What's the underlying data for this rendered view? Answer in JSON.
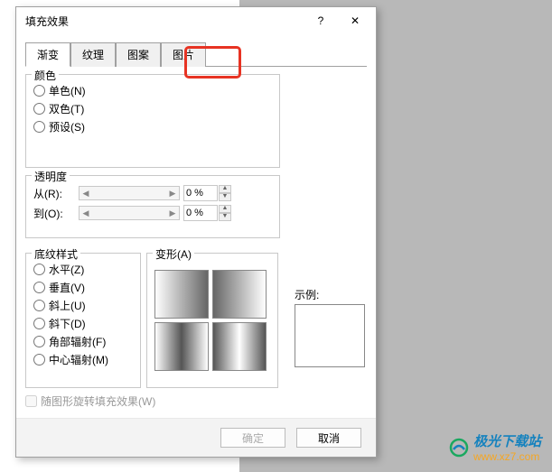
{
  "dialog": {
    "title": "填充效果",
    "help": "?",
    "close": "✕"
  },
  "tabs": {
    "gradient": "渐变",
    "texture": "纹理",
    "pattern": "图案",
    "picture": "图片"
  },
  "color": {
    "legend": "颜色",
    "single": "单色(N)",
    "double": "双色(T)",
    "preset": "预设(S)"
  },
  "transparency": {
    "legend": "透明度",
    "from_label": "从(R):",
    "to_label": "到(O):",
    "from_value": "0 %",
    "to_value": "0 %"
  },
  "style": {
    "legend": "底纹样式",
    "horizontal": "水平(Z)",
    "vertical": "垂直(V)",
    "diag_up": "斜上(U)",
    "diag_down": "斜下(D)",
    "corner": "角部辐射(F)",
    "center": "中心辐射(M)"
  },
  "variant": {
    "legend": "变形(A)"
  },
  "sample": {
    "label": "示例:"
  },
  "rotate_checkbox": "随图形旋转填充效果(W)",
  "buttons": {
    "ok": "确定",
    "cancel": "取消"
  },
  "watermark": {
    "name": "极光下载站",
    "url": "www.xz7.com"
  }
}
